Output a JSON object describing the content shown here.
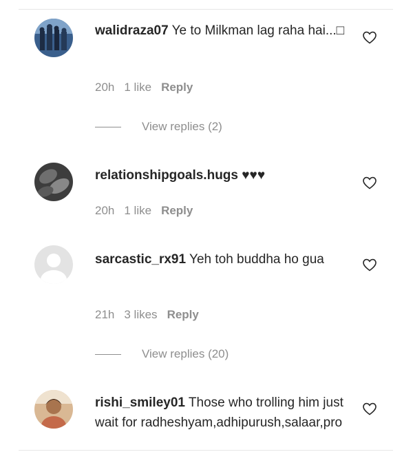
{
  "comments": [
    {
      "username": "walidraza07",
      "text": "Ye to Milkman lag raha hai...□",
      "time": "20h",
      "likes": "1 like",
      "reply_label": "Reply",
      "view_replies": "View replies (2)"
    },
    {
      "username": "relationshipgoals.hugs",
      "text": "♥♥♥",
      "time": "20h",
      "likes": "1 like",
      "reply_label": "Reply"
    },
    {
      "username": "sarcastic_rx91",
      "text": "Yeh toh buddha ho gua",
      "time": "21h",
      "likes": "3 likes",
      "reply_label": "Reply",
      "view_replies": "View replies (20)"
    },
    {
      "username": "rishi_smiley01",
      "text": "Those who trolling him just wait for radheshyam,adhipurush,salaar,pro"
    }
  ]
}
